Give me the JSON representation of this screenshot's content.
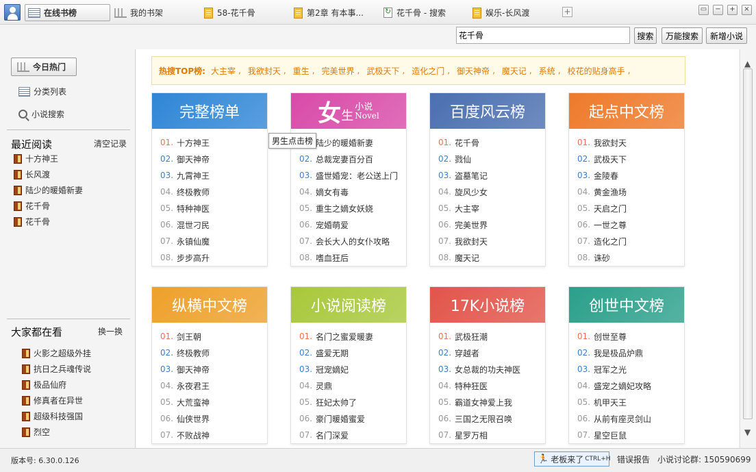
{
  "tabs": [
    {
      "label": "在线书榜",
      "icon": "list-icon",
      "active": true
    },
    {
      "label": "我的书架",
      "icon": "bookshelf-icon"
    },
    {
      "label": "58-花千骨",
      "icon": "document-icon"
    },
    {
      "label": "第2章  有本事...",
      "icon": "document-icon"
    },
    {
      "label": "花千骨 - 搜索",
      "icon": "refresh-page-icon"
    },
    {
      "label": "娱乐-长风渡",
      "icon": "document-icon"
    }
  ],
  "window_controls": [
    "▭",
    "−",
    "+",
    "×"
  ],
  "search": {
    "value": "花千骨",
    "search_button": "搜索",
    "universal_search_button": "万能搜索",
    "add_novel_button": "新增小说"
  },
  "sidebar": {
    "hot_today": "今日热门",
    "category_list": "分类列表",
    "novel_search": "小说搜索",
    "recent_title": "最近阅读",
    "clear_history": "清空记录",
    "recent": [
      "十方神王",
      "长风渡",
      "陆少的暖婚新妻",
      "花千骨",
      "花千骨"
    ],
    "watching_title": "大家都在看",
    "swap": "换一换",
    "watching": [
      "火影之超级外挂",
      "抗日之兵魂传说",
      "极品仙府",
      "修真者在异世",
      "超级科技强国",
      "烈空"
    ]
  },
  "hot_search": {
    "label": "热搜TOP榜:",
    "words": [
      "大主宰",
      "我欲封天",
      "重生",
      "完美世界",
      "武极天下",
      "造化之门",
      "御天神帝",
      "魔天记",
      "系统",
      "校花的贴身高手"
    ]
  },
  "tooltip": "男生点击榜",
  "cards": [
    {
      "title": "完整榜单",
      "color": "#2f86d6",
      "items": [
        "十方神王",
        "御天神帝",
        "九霄神王",
        "终极教师",
        "特种神医",
        "混世刁民",
        "永镇仙魔",
        "步步高升"
      ]
    },
    {
      "title_big": "女",
      "title_small1": "生",
      "title_small2": "小说",
      "title_small3": "Novel",
      "color": "#d84aa8",
      "items": [
        "陆少的暖婚新妻",
        "总裁宠妻百分百",
        "盛世婚宠：老公送上门",
        "嫡女有毒",
        "重生之嫡女妖娆",
        "宠婚萌爱",
        "会长大人的女仆攻略",
        "嗜血狂后"
      ]
    },
    {
      "title": "百度风云榜",
      "color": "#4a6fb0",
      "items": [
        "花千骨",
        "戮仙",
        "盗墓笔记",
        "旋风少女",
        "大主宰",
        "完美世界",
        "我欲封天",
        "魔天记"
      ]
    },
    {
      "title": "起点中文榜",
      "color": "#ee7a2a",
      "items": [
        "我欲封天",
        "武极天下",
        "金陵春",
        "黄金渔场",
        "天启之门",
        "一世之尊",
        "造化之门",
        "诛砂"
      ]
    },
    {
      "title": "纵横中文榜",
      "color": "#eea02a",
      "items": [
        "剑王朝",
        "终极教师",
        "御天神帝",
        "永夜君王",
        "大荒蛮神",
        "仙侠世界",
        "不败战神"
      ]
    },
    {
      "title": "小说阅读榜",
      "color": "#a8c83a",
      "items": [
        "名门之蜜爱暖妻",
        "盛爱无期",
        "冠宠嫡妃",
        "灵鼎",
        "狂妃太帅了",
        "豪门暖婚蜜爱",
        "名门深爱"
      ]
    },
    {
      "title": "17K小说榜",
      "color": "#e2544a",
      "items": [
        "武极狂潮",
        "穿越者",
        "女总裁的功夫神医",
        "特种狂医",
        "霸道女神爱上我",
        "三国之无限召唤",
        "星罗万相"
      ]
    },
    {
      "title": "创世中文榜",
      "color": "#2aa08a",
      "items": [
        "创世至尊",
        "我是极品炉鼎",
        "冠军之光",
        "盛宠之嫡妃攻略",
        "机甲天王",
        "从前有座灵剑山",
        "星空巨鼠"
      ]
    }
  ],
  "status": {
    "version": "版本号: 6.30.0.126",
    "boss_key": "老板来了",
    "boss_shortcut": "CTRL+H",
    "error_report": "错误报告",
    "discussion_group": "小说讨论群: 150590699"
  }
}
